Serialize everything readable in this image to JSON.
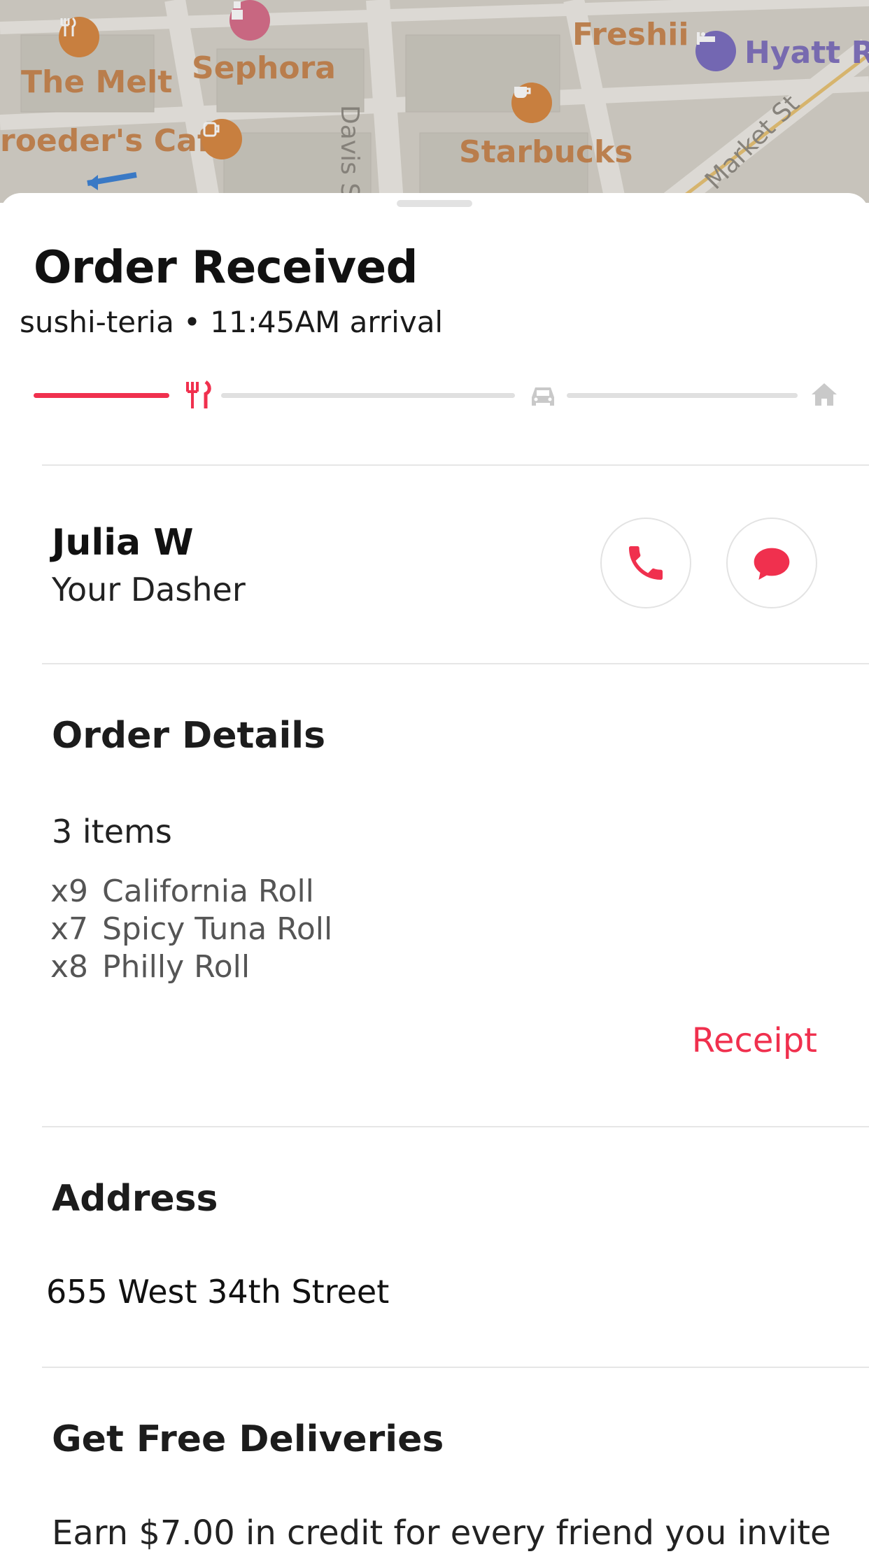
{
  "map": {
    "places": [
      {
        "name": "The Melt",
        "icon": "restaurant-icon"
      },
      {
        "name": "Sephora",
        "icon": "cosmetics-icon"
      },
      {
        "name": "Freshii",
        "icon": "restaurant-icon"
      },
      {
        "name": "Hyatt Reg",
        "icon": "hotel-icon"
      },
      {
        "name": "roeder's Cafe",
        "icon": "cafe-icon"
      },
      {
        "name": "Starbucks",
        "icon": "coffee-icon"
      }
    ],
    "streets": [
      "Davis St",
      "Market St"
    ]
  },
  "order": {
    "status_title": "Order Received",
    "subtitle": "sushi-teria • 11:45AM arrival",
    "progress_stages": [
      "restaurant-icon",
      "car-icon",
      "home-icon"
    ],
    "progress_fraction": 0.12
  },
  "dasher": {
    "name": "Julia W",
    "role": "Your Dasher",
    "call_icon": "phone-icon",
    "message_icon": "chat-bubble-icon"
  },
  "details": {
    "title": "Order Details",
    "count": "3 items",
    "items": [
      {
        "qty": "x9",
        "name": "California Roll"
      },
      {
        "qty": "x7",
        "name": "Spicy Tuna Roll"
      },
      {
        "qty": "x8",
        "name": "Philly Roll"
      }
    ],
    "receipt_label": "Receipt"
  },
  "address": {
    "title": "Address",
    "line": "655 West 34th Street"
  },
  "promo": {
    "title": "Get Free Deliveries",
    "text": "Earn $7.00 in credit for every friend you invite"
  },
  "colors": {
    "accent": "#f0304e",
    "inactive": "#e0e0e0"
  }
}
